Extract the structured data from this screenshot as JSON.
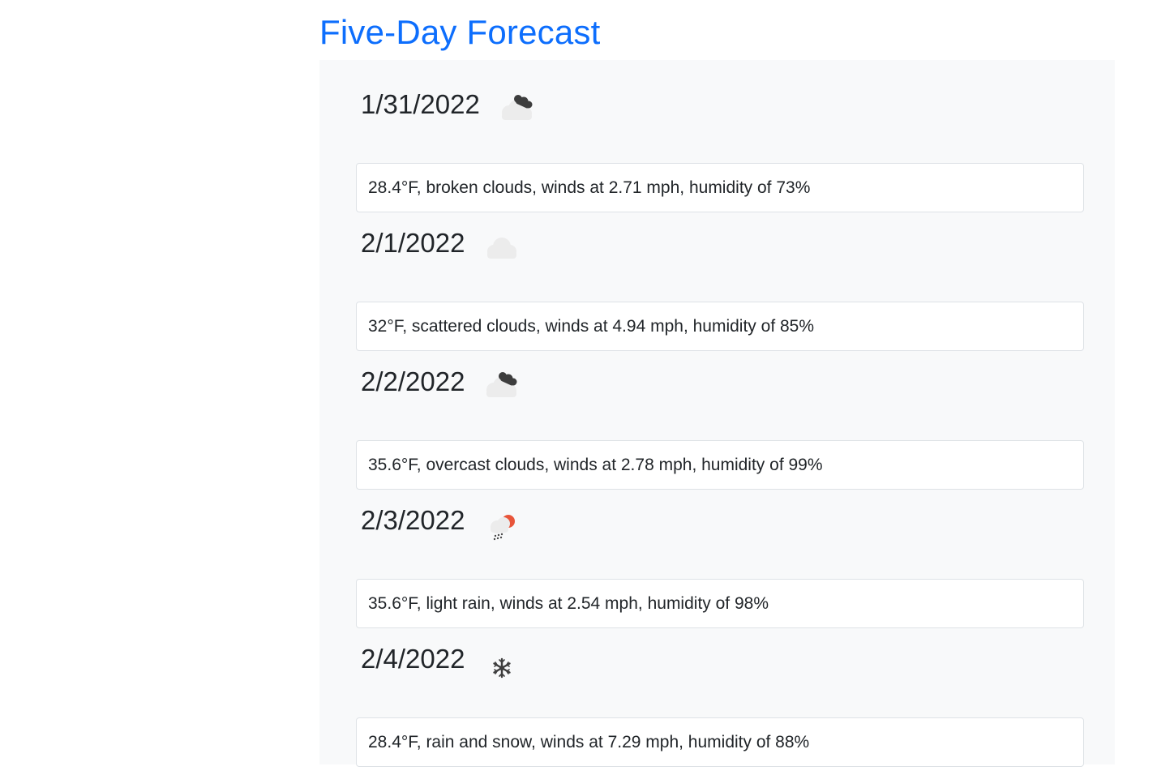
{
  "page": {
    "title": "Five-Day Forecast"
  },
  "colors": {
    "title": "#0d6efd",
    "panel_bg": "#f8f9fa",
    "card_border": "#dee2e6"
  },
  "forecast": [
    {
      "date": "1/31/2022",
      "icon": "broken-clouds-icon",
      "summary": "28.4°F, broken clouds, winds at 2.71 mph, humidity of 73%"
    },
    {
      "date": "2/1/2022",
      "icon": "scattered-clouds-icon",
      "summary": "32°F, scattered clouds, winds at 4.94 mph, humidity of 85%"
    },
    {
      "date": "2/2/2022",
      "icon": "overcast-clouds-icon",
      "summary": "35.6°F, overcast clouds, winds at 2.78 mph, humidity of 99%"
    },
    {
      "date": "2/3/2022",
      "icon": "light-rain-icon",
      "summary": "35.6°F, light rain, winds at 2.54 mph, humidity of 98%"
    },
    {
      "date": "2/4/2022",
      "icon": "snow-icon",
      "summary": "28.4°F, rain and snow, winds at 7.29 mph, humidity of 88%"
    }
  ]
}
